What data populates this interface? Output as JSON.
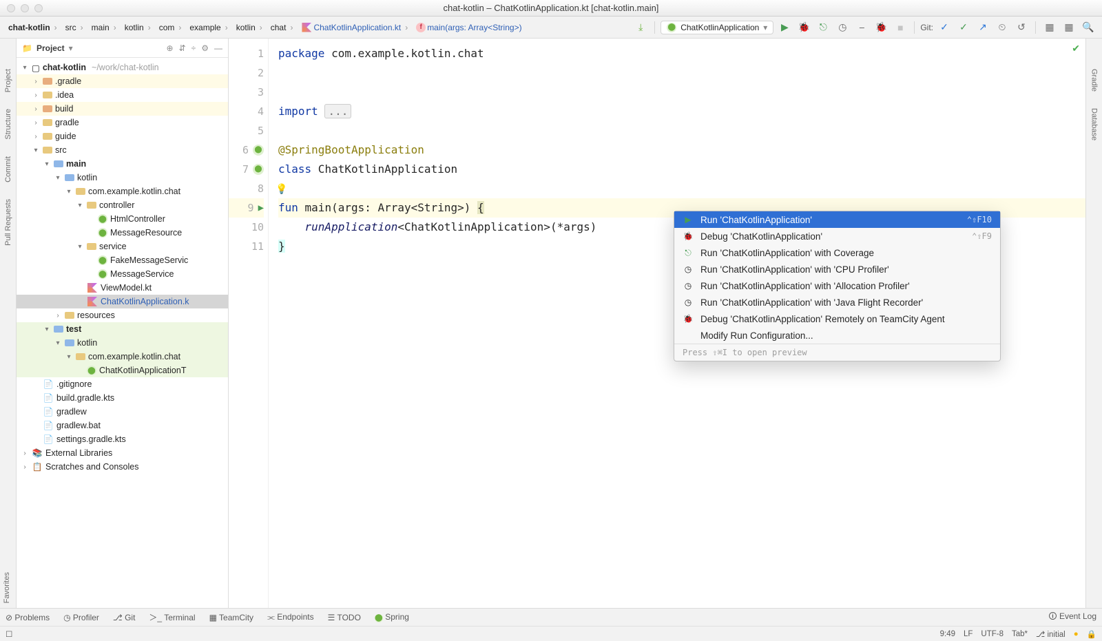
{
  "window_title": "chat-kotlin – ChatKotlinApplication.kt [chat-kotlin.main]",
  "breadcrumbs": {
    "b0": "chat-kotlin",
    "b1": "src",
    "b2": "main",
    "b3": "kotlin",
    "b4": "com",
    "b5": "example",
    "b6": "kotlin",
    "b7": "chat",
    "file": "ChatKotlinApplication.kt",
    "fn": "main(args: Array<String>)"
  },
  "run_config": "ChatKotlinApplication",
  "git_label": "Git:",
  "project": {
    "header_title": "Project",
    "root": "chat-kotlin",
    "root_path": "~/work/chat-kotlin",
    "nodes": {
      "gradle_hidden": ".gradle",
      "idea_hidden": ".idea",
      "build": "build",
      "gradle": "gradle",
      "guide": "guide",
      "src": "src",
      "main": "main",
      "kotlin": "kotlin",
      "pkg_main": "com.example.kotlin.chat",
      "controller": "controller",
      "html_ctrl": "HtmlController",
      "msg_res": "MessageResource",
      "service": "service",
      "fake_msg": "FakeMessageServic",
      "msg_svc": "MessageService",
      "view_model": "ViewModel.kt",
      "app_file": "ChatKotlinApplication.k",
      "resources": "resources",
      "test": "test",
      "test_kotlin": "kotlin",
      "pkg_test": "com.example.kotlin.chat",
      "app_test": "ChatKotlinApplicationT",
      "gitignore": ".gitignore",
      "build_kts": "build.gradle.kts",
      "gradlew": "gradlew",
      "gradlew_bat": "gradlew.bat",
      "settings_kts": "settings.gradle.kts",
      "ext_lib": "External Libraries",
      "scratches": "Scratches and Consoles"
    }
  },
  "code": {
    "l1a": "package",
    "l1b": " com.example.kotlin.chat",
    "l4a": "import ",
    "l4b": "...",
    "l6": "@SpringBootApplication",
    "l7a": "class",
    "l7b": " ChatKotlinApplication",
    "l9a": "fun",
    "l9b": " main(args: Array<String>) ",
    "l9c": "{",
    "l10a": "    ",
    "l10b": "runApplication",
    "l10c": "<ChatKotlinApplication>(*args)",
    "l11": "}"
  },
  "gutter": {
    "n1": "1",
    "n2": "2",
    "n3": "3",
    "n4": "4",
    "n5": "5",
    "n6": "6",
    "n7": "7",
    "n8": "8",
    "n9": "9",
    "n10": "10",
    "n11": "11"
  },
  "popup": {
    "run": "Run 'ChatKotlinApplication'",
    "debug": "Debug 'ChatKotlinApplication'",
    "coverage": "Run 'ChatKotlinApplication' with Coverage",
    "cpu": "Run 'ChatKotlinApplication' with 'CPU Profiler'",
    "alloc": "Run 'ChatKotlinApplication' with 'Allocation Profiler'",
    "jfr": "Run 'ChatKotlinApplication' with 'Java Flight Recorder'",
    "teamcity": "Debug 'ChatKotlinApplication' Remotely on TeamCity Agent",
    "modify": "Modify Run Configuration...",
    "sc_run": "⌃⇧F10",
    "sc_debug": "⌃⇧F9",
    "footer": "Press ⇧⌘I to open preview"
  },
  "left_rail": {
    "project": "Project",
    "structure": "Structure",
    "commit": "Commit",
    "pull": "Pull Requests"
  },
  "right_rail": {
    "gradle": "Gradle",
    "db": "Database"
  },
  "fav": "Favorites",
  "bottom": {
    "problems": "Problems",
    "profiler": "Profiler",
    "git": "Git",
    "terminal": "Terminal",
    "teamcity": "TeamCity",
    "endpoints": "Endpoints",
    "todo": "TODO",
    "spring": "Spring",
    "eventlog": "Event Log"
  },
  "status": {
    "pos": "9:49",
    "lf": "LF",
    "enc": "UTF-8",
    "tab": "Tab*",
    "branch": "initial"
  }
}
